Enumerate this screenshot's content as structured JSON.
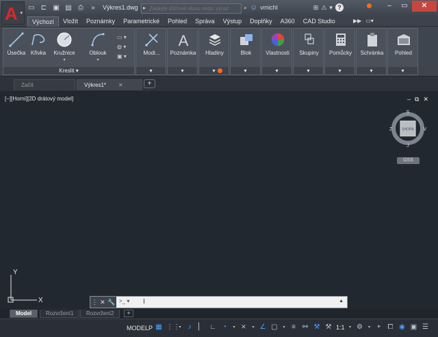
{
  "app": {
    "logo_letter": "A",
    "document_title": "Výkres1.dwg",
    "search_placeholder": "Zadejte klíčové slovo nebo výraz",
    "username": "vmichl",
    "help_label": "?",
    "colors": {
      "titlebar": "#4a505a",
      "logo": "#d42a2a",
      "close_button": "#c7473f",
      "notify": "#ff6a1a",
      "accent": "#4aa0ff"
    }
  },
  "ribbon_tabs": [
    "Výchozí",
    "Vložit",
    "Poznámky",
    "Parametrické",
    "Pohled",
    "Správa",
    "Výstup",
    "Doplňky",
    "A360",
    "CAD Studio"
  ],
  "active_ribbon_tab": "Výchozí",
  "ribbon": {
    "draw_panel": {
      "label": "Kreslit",
      "tools": [
        {
          "label": "Úsečka",
          "icon": "line-icon"
        },
        {
          "label": "Křivka",
          "icon": "polyline-icon"
        },
        {
          "label": "Kružnice",
          "icon": "circle-icon"
        },
        {
          "label": "Oblouk",
          "icon": "arc-icon"
        }
      ]
    },
    "panels": [
      {
        "label": "Modi...",
        "icon": "modify-icon"
      },
      {
        "label": "Poznámka",
        "icon": "annotation-icon"
      },
      {
        "label": "Hladiny",
        "icon": "layers-icon"
      },
      {
        "label": "Blok",
        "icon": "block-icon"
      },
      {
        "label": "Vlastnosti",
        "icon": "properties-icon"
      },
      {
        "label": "Skupiny",
        "icon": "groups-icon"
      },
      {
        "label": "Pomůcky",
        "icon": "utilities-icon"
      },
      {
        "label": "Schránka",
        "icon": "clipboard-icon"
      },
      {
        "label": "Pohled",
        "icon": "view-icon"
      }
    ]
  },
  "doc_tabs": [
    {
      "label": "Začít",
      "active": false
    },
    {
      "label": "Výkres1*",
      "active": true
    }
  ],
  "viewport": {
    "label": "[−][Horní][2D drátový model]",
    "viewcube": {
      "north": "S",
      "south": "J",
      "west": "Z",
      "east": "V",
      "face": "SHORA"
    },
    "coord_system": "GSS",
    "ucs": {
      "x": "X",
      "y": "Y"
    }
  },
  "commandline": {
    "prompt_icon": ">_",
    "value": ""
  },
  "layout_tabs": [
    {
      "label": "Model",
      "active": true
    },
    {
      "label": "Rozvržení1",
      "active": false
    },
    {
      "label": "Rozvržení2",
      "active": false
    }
  ],
  "statusbar": {
    "space_label": "MODELP",
    "annotation_scale": "1:1"
  }
}
